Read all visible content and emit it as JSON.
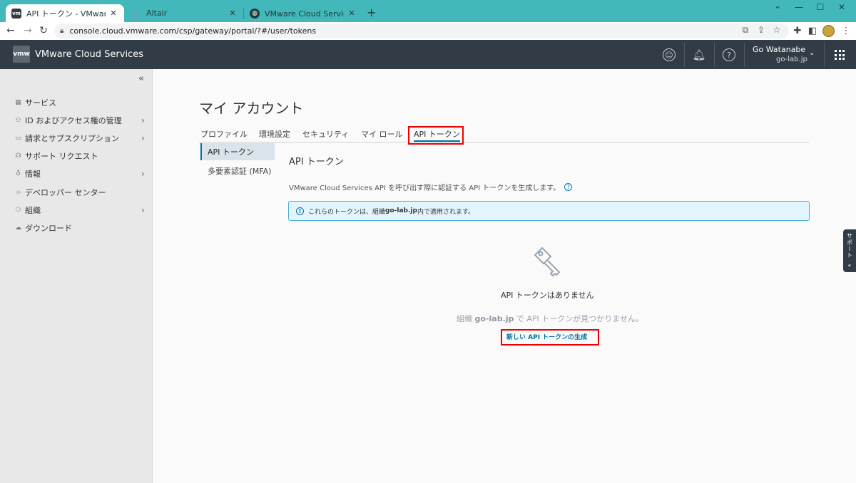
{
  "browser": {
    "tabs": [
      {
        "title": "API トークン - VMware Cloud Servic",
        "close": "✕"
      },
      {
        "title": "Altair",
        "close": "✕"
      },
      {
        "title": "VMware Cloud Services - ログイン",
        "close": "✕"
      }
    ],
    "new_tab": "+",
    "window_controls": {
      "chevron": "⌄",
      "minimize": "—",
      "maximize": "☐",
      "close": "✕"
    },
    "url": "console.cloud.vmware.com/csp/gateway/portal/?#/user/tokens",
    "favicon_text": "vm",
    "tab_accent": "#42b8ba"
  },
  "header": {
    "logo": "vmw",
    "title": "VMware Cloud Services",
    "user_name": "Go Watanabe",
    "user_org": "go-lab.jp",
    "bg": "#313c46"
  },
  "sidebar": {
    "collapse": "«",
    "items": [
      {
        "label": "サービス",
        "icon": "grid-icon",
        "glyph": "▦",
        "chevron": false
      },
      {
        "label": "ID およびアクセス権の管理",
        "icon": "users-icon",
        "glyph": "⚇",
        "chevron": true
      },
      {
        "label": "請求とサブスクリプション",
        "icon": "billing-icon",
        "glyph": "▭",
        "chevron": true
      },
      {
        "label": "サポート リクエスト",
        "icon": "headset-icon",
        "glyph": "☊",
        "chevron": false
      },
      {
        "label": "情報",
        "icon": "lightbulb-icon",
        "glyph": "♁",
        "chevron": true
      },
      {
        "label": "デベロッパー センター",
        "icon": "code-icon",
        "glyph": "‹/›",
        "chevron": false
      },
      {
        "label": "組織",
        "icon": "org-icon",
        "glyph": "⚆",
        "chevron": true
      },
      {
        "label": "ダウンロード",
        "icon": "download-cloud-icon",
        "glyph": "☁",
        "chevron": false
      }
    ]
  },
  "main": {
    "page_title": "マイ アカウント",
    "tabs": [
      "プロファイル",
      "環境設定",
      "セキュリティ",
      "マイ ロール",
      "API トークン"
    ],
    "subnav": [
      "API トークン",
      "多要素認証 (MFA)"
    ],
    "section_title": "API トークン",
    "description": "VMware Cloud Services API を呼び出す際に認証する API トークンを生成します。",
    "info_prefix": "これらのトークンは、組織 ",
    "info_org": "go-lab.jp",
    "info_suffix": " 内で適用されます。",
    "empty_title": "API トークンはありません",
    "empty_prefix": "組織 ",
    "empty_org": "go-lab.jp",
    "empty_suffix": " で API トークンが見つかりません。",
    "generate_link": "新しい API トークンの生成",
    "support_tab": "サポート"
  },
  "colors": {
    "accent": "#0072a3",
    "highlight": "#e00000",
    "info_bg": "#e3f5fc"
  }
}
